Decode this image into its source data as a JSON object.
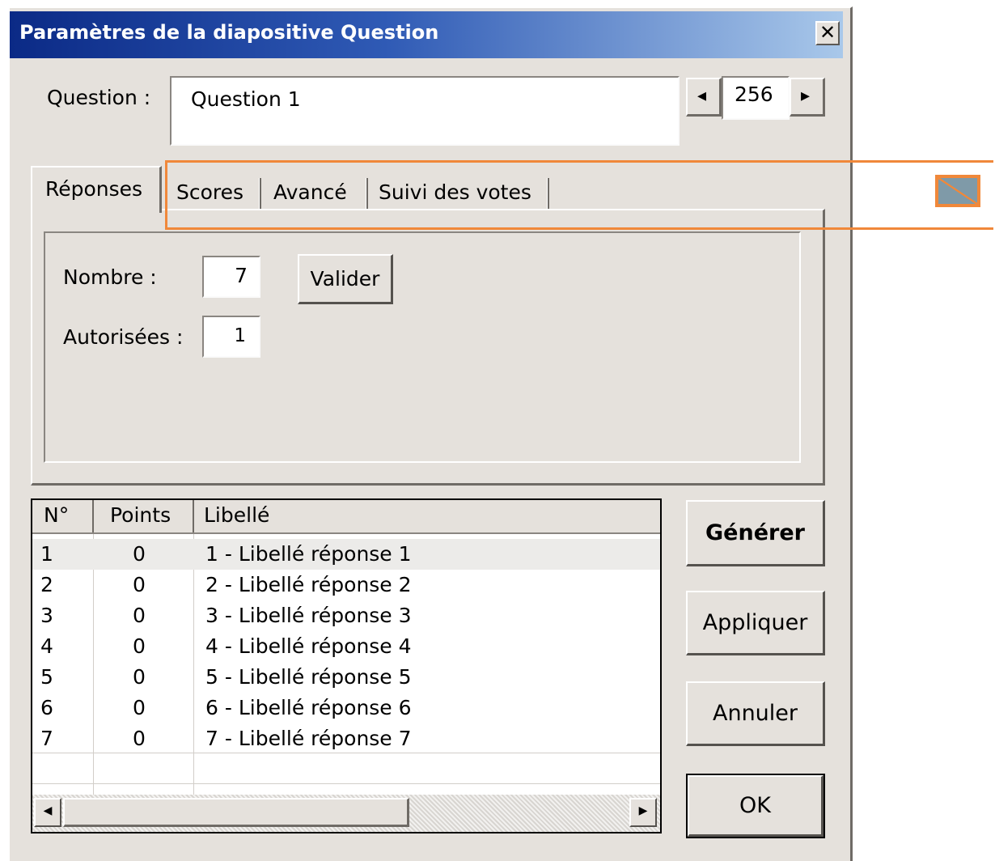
{
  "window": {
    "title": "Paramètres de la diapositive Question",
    "close_glyph": "✕"
  },
  "question": {
    "label": "Question :",
    "value": "Question  1",
    "counter": "256",
    "prev_glyph": "◂",
    "next_glyph": "▸"
  },
  "tabs": [
    {
      "label": "Réponses",
      "active": true
    },
    {
      "label": "Scores",
      "active": false
    },
    {
      "label": "Avancé",
      "active": false
    },
    {
      "label": "Suivi des votes",
      "active": false
    }
  ],
  "answers_panel": {
    "nombre_label": "Nombre :",
    "nombre_value": "7",
    "valider_label": "Valider",
    "autorisees_label": "Autorisées :",
    "autorisees_value": "1"
  },
  "table": {
    "columns": [
      "N°",
      "Points",
      "Libellé"
    ],
    "rows": [
      {
        "n": "1",
        "points": "0",
        "label": "1 - Libellé réponse 1"
      },
      {
        "n": "2",
        "points": "0",
        "label": "2 - Libellé réponse 2"
      },
      {
        "n": "3",
        "points": "0",
        "label": "3 - Libellé réponse 3"
      },
      {
        "n": "4",
        "points": "0",
        "label": "4 - Libellé réponse 4"
      },
      {
        "n": "5",
        "points": "0",
        "label": "5 - Libellé réponse 5"
      },
      {
        "n": "6",
        "points": "0",
        "label": "6 - Libellé réponse 6"
      },
      {
        "n": "7",
        "points": "0",
        "label": "7 - Libellé réponse 7"
      }
    ],
    "scroll_left_glyph": "◀",
    "scroll_right_glyph": "▶"
  },
  "buttons": {
    "generer": "Générer",
    "appliquer": "Appliquer",
    "annuler": "Annuler",
    "ok": "OK"
  },
  "colors": {
    "annotation": "#f0883a",
    "dialog_bg": "#e5e1dc",
    "titlebar_start": "#0b2a86",
    "titlebar_end": "#a9c8ea"
  }
}
